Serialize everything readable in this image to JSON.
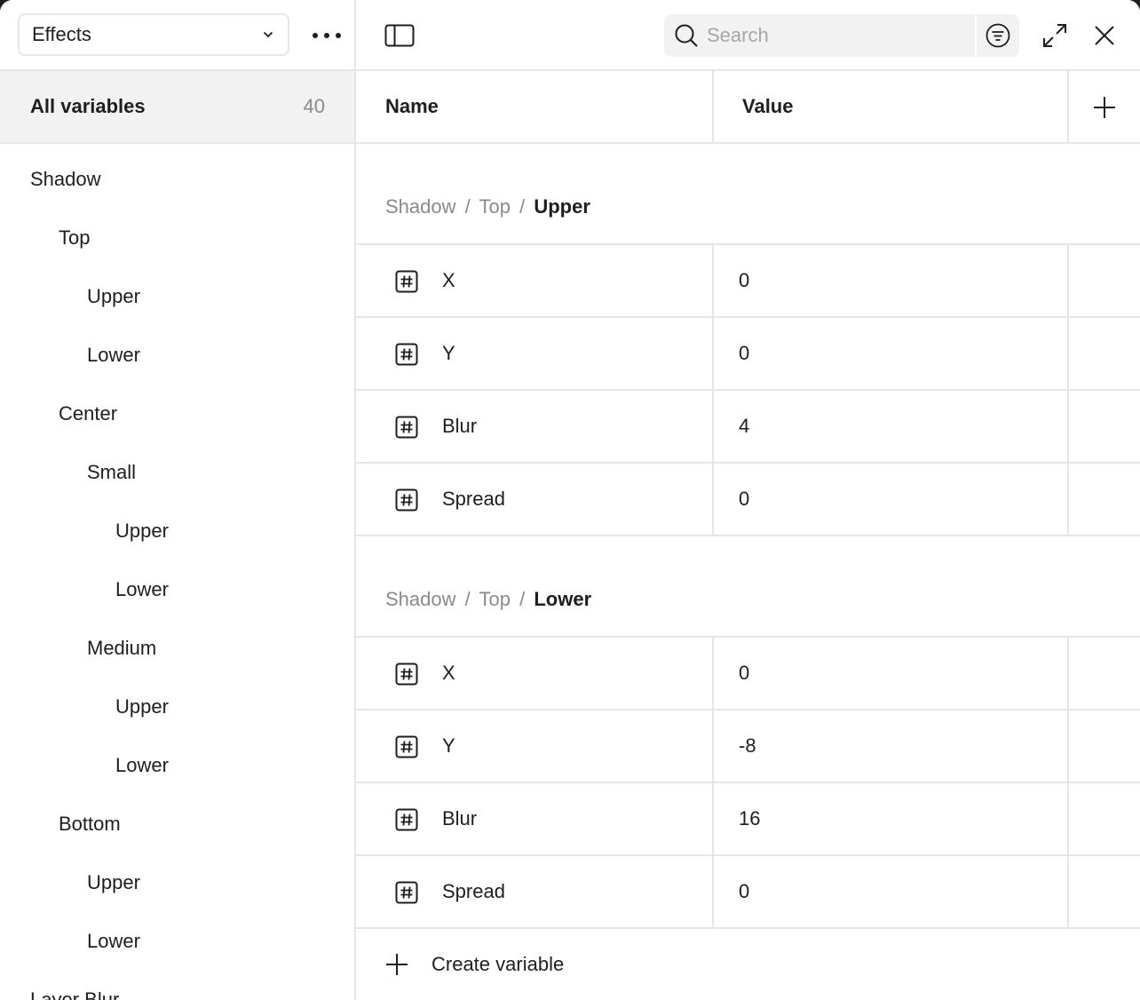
{
  "sidebar": {
    "collection": "Effects",
    "all_variables": {
      "label": "All variables",
      "count": "40"
    },
    "tree": [
      {
        "label": "Shadow",
        "level": 0
      },
      {
        "label": "Top",
        "level": 1
      },
      {
        "label": "Upper",
        "level": 2
      },
      {
        "label": "Lower",
        "level": 2
      },
      {
        "label": "Center",
        "level": 1
      },
      {
        "label": "Small",
        "level": 2
      },
      {
        "label": "Upper",
        "level": 3
      },
      {
        "label": "Lower",
        "level": 3
      },
      {
        "label": "Medium",
        "level": 2
      },
      {
        "label": "Upper",
        "level": 3
      },
      {
        "label": "Lower",
        "level": 3
      },
      {
        "label": "Bottom",
        "level": 1
      },
      {
        "label": "Upper",
        "level": 2
      },
      {
        "label": "Lower",
        "level": 2
      },
      {
        "label": "Layer Blur",
        "level": 0
      }
    ]
  },
  "toolbar": {
    "search_placeholder": "Search"
  },
  "table": {
    "name_header": "Name",
    "value_header": "Value",
    "groups": [
      {
        "path": [
          "Shadow",
          "Top"
        ],
        "leaf": "Upper",
        "rows": [
          {
            "name": "X",
            "value": "0",
            "type_icon": "number-icon"
          },
          {
            "name": "Y",
            "value": "0",
            "type_icon": "number-icon"
          },
          {
            "name": "Blur",
            "value": "4",
            "type_icon": "number-icon"
          },
          {
            "name": "Spread",
            "value": "0",
            "type_icon": "number-icon"
          }
        ]
      },
      {
        "path": [
          "Shadow",
          "Top"
        ],
        "leaf": "Lower",
        "rows": [
          {
            "name": "X",
            "value": "0",
            "type_icon": "number-icon"
          },
          {
            "name": "Y",
            "value": "-8",
            "type_icon": "number-icon"
          },
          {
            "name": "Blur",
            "value": "16",
            "type_icon": "number-icon"
          },
          {
            "name": "Spread",
            "value": "0",
            "type_icon": "number-icon"
          }
        ]
      }
    ],
    "separator": "/",
    "create_label": "Create variable"
  }
}
